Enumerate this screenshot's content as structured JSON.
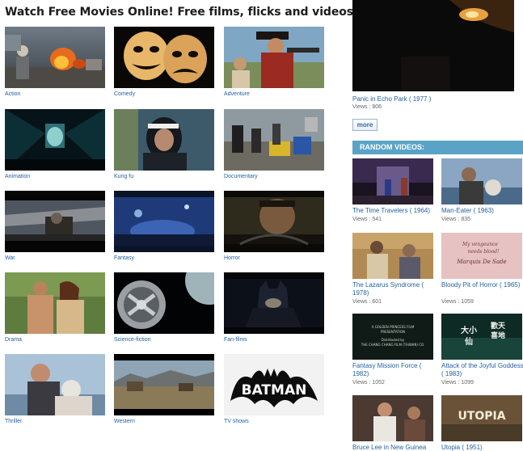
{
  "page_title": "Watch Free Movies Online! Free films, flicks and videos!",
  "categories": [
    {
      "label": "Action"
    },
    {
      "label": "Comedy"
    },
    {
      "label": "Adventure"
    },
    {
      "label": "Animation"
    },
    {
      "label": "Kung fu"
    },
    {
      "label": "Documentary"
    },
    {
      "label": "War"
    },
    {
      "label": "Fantasy"
    },
    {
      "label": "Horror"
    },
    {
      "label": "Drama"
    },
    {
      "label": "Science-fiction"
    },
    {
      "label": "Fan-films"
    },
    {
      "label": "Thriller"
    },
    {
      "label": "Western"
    },
    {
      "label": "TV shows"
    }
  ],
  "featured": {
    "title": "Panic in Echo Park ( 1977 )",
    "views": "Views : 806"
  },
  "more_label": "more",
  "random_header": "RANDOM VIDEOS:",
  "random_videos": [
    {
      "title": "The Time Travelers ( 1964)",
      "views": "Views : 541"
    },
    {
      "title": "Man-Eater ( 1963)",
      "views": "Views : 835"
    },
    {
      "title": "The Lazarus Syndrome ( 1978)",
      "views": "Views : 601"
    },
    {
      "title": "Bloody Pit of Horror ( 1965)",
      "views": "Views : 1059"
    },
    {
      "title": "Fantasy Mission Force ( 1982)",
      "views": "Views : 1052"
    },
    {
      "title": "Attack of the Joyful Goddess ( 1983)",
      "views": "Views : 1099"
    },
    {
      "title": "Bruce Lee in New Guinea",
      "views": ""
    },
    {
      "title": "Utopia ( 1951)",
      "views": ""
    }
  ],
  "thumb_captions": {
    "pink_title_line1": "My vengeance",
    "pink_title_line2": "needs blood!",
    "pink_title_line3": "Marquis De Sade",
    "credits_line1": "A GOLDEN PRINCESS FILM",
    "credits_line2": "PRESENTATION",
    "credits_line3": "Distributed by",
    "credits_line4": "THE CHANG CHANG FILM (TAIWAN) CO.",
    "goddess_line1": "歡天",
    "goddess_line2": "喜地",
    "goddess_line3": "大小",
    "goddess_line4": "仙",
    "utopia": "UTOPIA",
    "batman": "BATMAN"
  }
}
